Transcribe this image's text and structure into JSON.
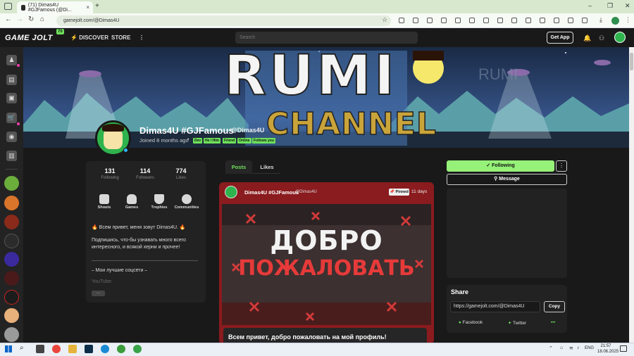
{
  "browser": {
    "tab_title": "(71) Dimas4U #GJFamous (@Di...",
    "tab_close": "×",
    "new_tab": "+",
    "url": "gamejolt.com/@Dimas4U",
    "win_min": "–",
    "win_max": "❐",
    "win_close": "✕"
  },
  "header": {
    "logo": "GAME JOLT",
    "logo_badge": "70",
    "discover": "DISCOVER",
    "store": "STORE",
    "search_placeholder": "Search",
    "get_app": "Get App"
  },
  "banner": {
    "title_line1": "RUMI",
    "title_line2": "CHANNEL",
    "watermark": "RUMI"
  },
  "profile": {
    "name": "Dimas4U #GJFamous",
    "handle": "@Dimas4U",
    "joined": "Joined 8 months ago",
    "dot": "•",
    "badges": [
      "Dev",
      "He / Him",
      "Friend",
      "Online",
      "Follows you"
    ]
  },
  "stats": [
    {
      "value": "131",
      "label": "Following"
    },
    {
      "value": "114",
      "label": "Followers"
    },
    {
      "value": "774",
      "label": "Likes"
    }
  ],
  "actions": [
    {
      "label": "Shouts",
      "icon": "chat-icon"
    },
    {
      "label": "Games",
      "icon": "gamepad-icon"
    },
    {
      "label": "Trophies",
      "icon": "trophy-icon"
    },
    {
      "label": "Communities",
      "icon": "communities-icon"
    }
  ],
  "bio": {
    "line1": "🔥 Всем привет, меня зовут Dimas4U. 🔥",
    "line2": "Подпишись, что-бы узнавать много всего интересного, и всякой херни и прочее!",
    "line3": "⎯ Мои лучшие соцсети ⎯",
    "youtube": "YouTube:",
    "more": "..."
  },
  "tabs": {
    "posts": "Posts",
    "likes": "Likes"
  },
  "post": {
    "author": "Dimas4U #GJFamous",
    "handle": "@Dimas4U",
    "pinned": "Pinned",
    "age": "11 days",
    "image_line1": "ДОБРО",
    "image_line2": "ПОЖАЛОВАТЬ",
    "text": "Всем привет, добро пожаловать на мой профиль!"
  },
  "right": {
    "following": "✓ Following",
    "more": "⋮",
    "message": "Message",
    "share_title": "Share",
    "share_url": "https://gamejolt.com/@Dimas4U",
    "copy": "Copy",
    "facebook": "Facebook",
    "twitter": "Twitter",
    "share_more": "•••"
  },
  "taskbar": {
    "lang": "ENG",
    "time": "21:57",
    "date": "18.06.2025"
  },
  "colors": {
    "accent": "#6ee15b",
    "following_bg": "#96f178",
    "post_bg": "#8a1b1e",
    "badge_pink": "#ff3fac"
  }
}
